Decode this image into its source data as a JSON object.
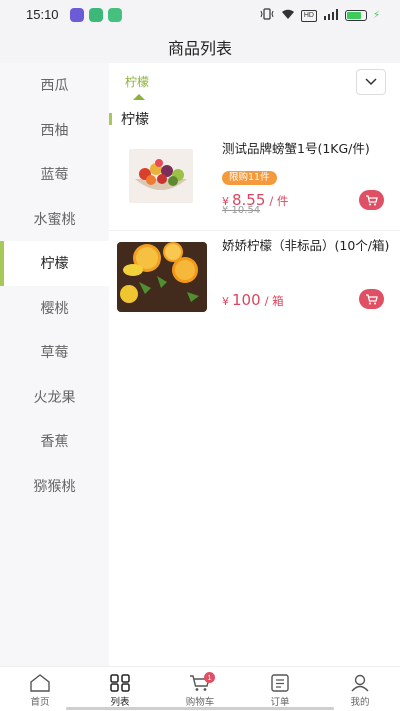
{
  "status_bar": {
    "time": "15:10",
    "hd": "HD"
  },
  "header": {
    "title": "商品列表"
  },
  "sidebar": {
    "items": [
      {
        "label": "西瓜"
      },
      {
        "label": "西柚"
      },
      {
        "label": "蓝莓"
      },
      {
        "label": "水蜜桃"
      },
      {
        "label": "柠檬",
        "active": true
      },
      {
        "label": "樱桃"
      },
      {
        "label": "草莓"
      },
      {
        "label": "火龙果"
      },
      {
        "label": "香蕉"
      },
      {
        "label": "猕猴桃"
      }
    ]
  },
  "main": {
    "active_tab": "柠檬",
    "section_title": "柠檬",
    "products": [
      {
        "name": "测试品牌螃蟹1号(1KG/件)",
        "limit_badge": "限购11件",
        "currency": "¥",
        "price": "8.55",
        "unit": "/ 件",
        "original_price": "¥ 10.54"
      },
      {
        "name": "娇娇柠檬（非标品）(10个/箱)",
        "currency": "¥",
        "price": "100",
        "unit": "/ 箱"
      }
    ]
  },
  "bottom_nav": {
    "items": [
      {
        "label": "首页",
        "icon": "home-icon"
      },
      {
        "label": "列表",
        "icon": "grid-icon",
        "active": true
      },
      {
        "label": "购物车",
        "icon": "cart-icon",
        "badge": "1"
      },
      {
        "label": "订单",
        "icon": "order-icon"
      },
      {
        "label": "我的",
        "icon": "profile-icon"
      }
    ]
  },
  "colors": {
    "accent": "#a8c95a",
    "tab_active": "#8cb339",
    "price": "#d9475f",
    "badge_orange": "#f59a3c",
    "cart_button": "#e05064"
  }
}
